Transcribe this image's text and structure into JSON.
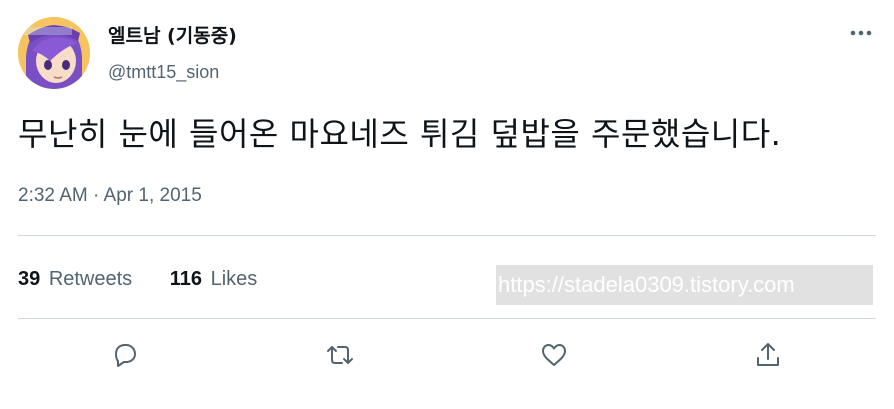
{
  "user": {
    "display_name": "엘트남 (기동중)",
    "handle": "@tmtt15_sion"
  },
  "tweet": {
    "text": "무난히 눈에 들어온 마요네즈 튀김 덮밥을 주문했습니다.",
    "timestamp": "2:32 AM · Apr 1, 2015"
  },
  "stats": {
    "retweets_count": "39",
    "retweets_label": "Retweets",
    "likes_count": "116",
    "likes_label": "Likes"
  },
  "watermark": "https://stadela0309.tistory.com",
  "actions": [
    "reply-icon",
    "retweet-icon",
    "like-icon",
    "share-icon"
  ],
  "colors": {
    "text": "#0f1419",
    "secondary": "#536471",
    "divider": "#cfd9de"
  }
}
